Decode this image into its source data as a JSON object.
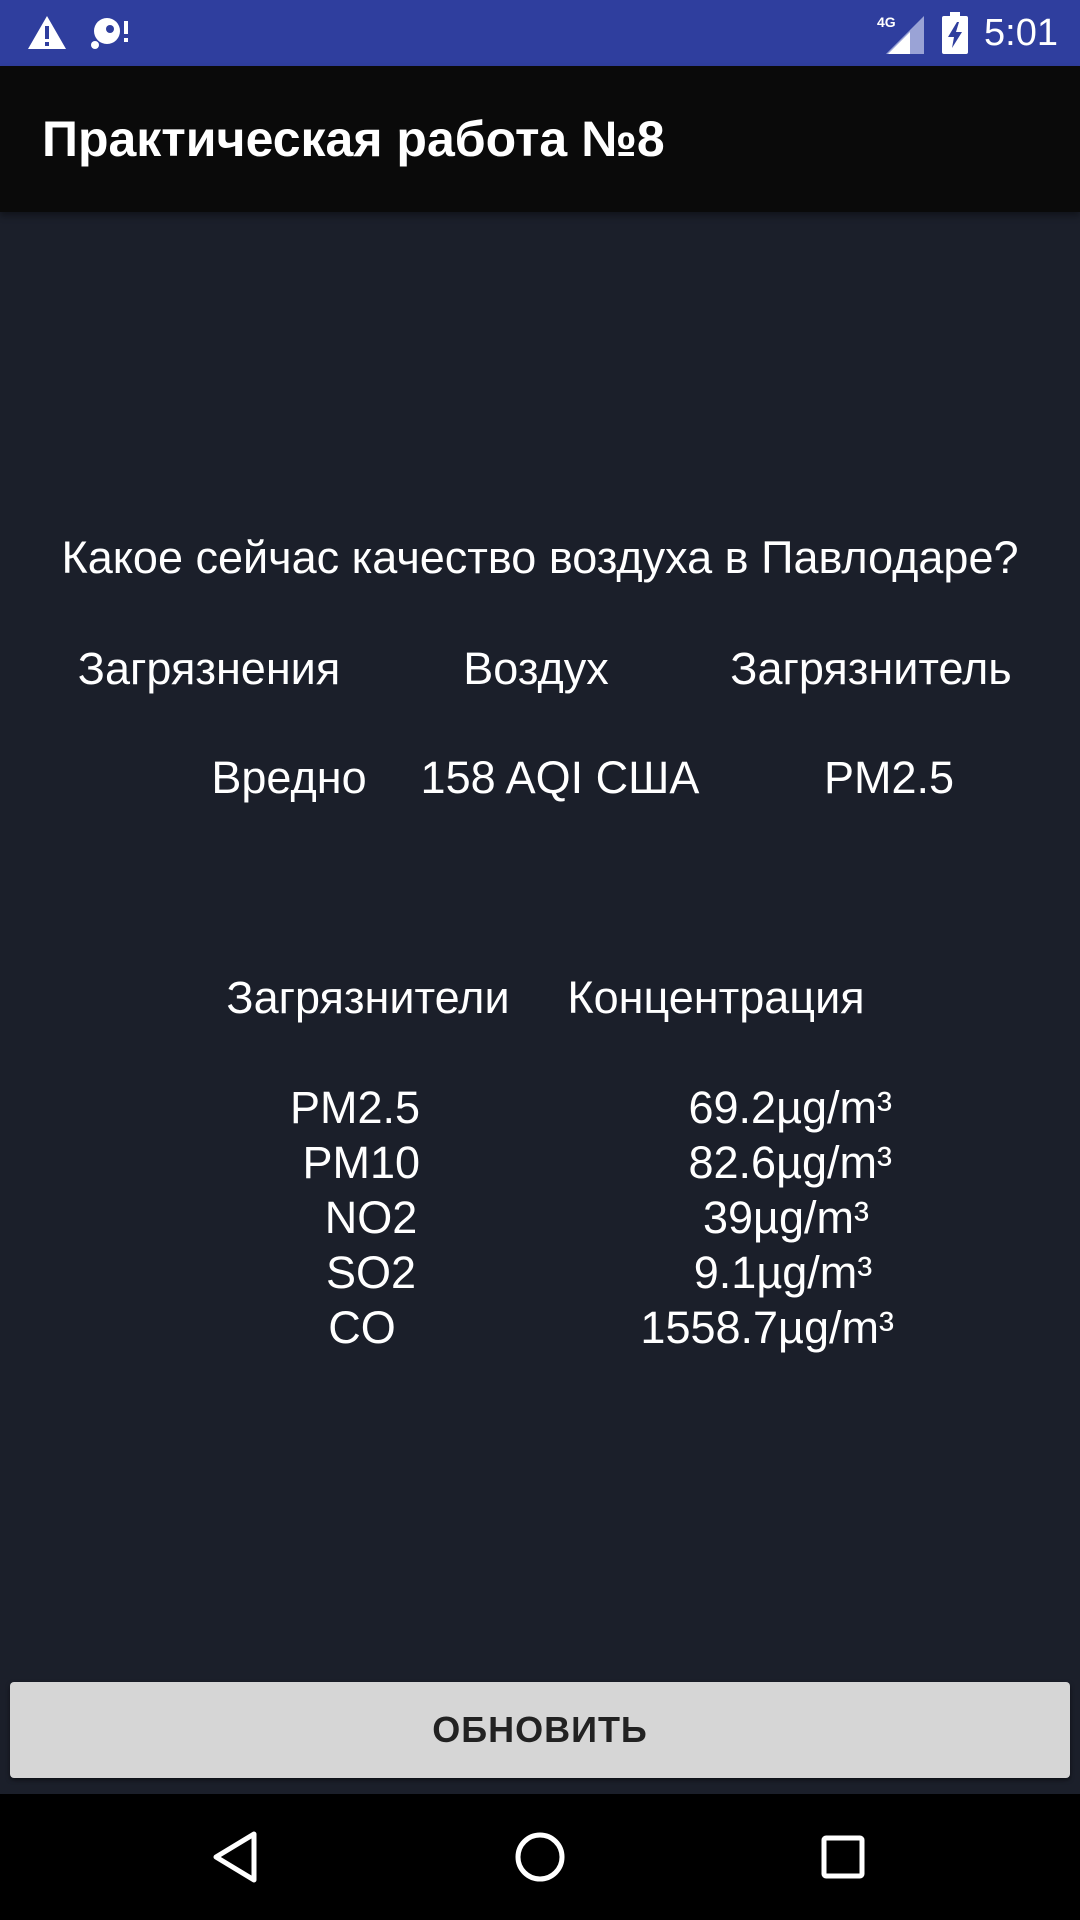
{
  "status_bar": {
    "network": "4G",
    "time": "5:01",
    "icons": [
      "warning-icon",
      "sd-card-icon",
      "signal-icon",
      "battery-charging-icon"
    ]
  },
  "app_bar": {
    "title": "Практическая работа №8"
  },
  "main": {
    "question": "Какое сейчас качество воздуха в Павлодаре?",
    "summary_headers": [
      "Загрязнения",
      "Воздух",
      "Загрязнитель"
    ],
    "summary_values": [
      "Вредно",
      "158 AQI США",
      "PM2.5"
    ],
    "pollutant_headers": [
      "Загрязнители",
      "Концентрация"
    ],
    "pollutants": [
      {
        "name": "PM2.5",
        "concentration": "69.2µg/m³"
      },
      {
        "name": "PM10",
        "concentration": "82.6µg/m³"
      },
      {
        "name": "NO2",
        "concentration": "39µg/m³"
      },
      {
        "name": "SO2",
        "concentration": "9.1µg/m³"
      },
      {
        "name": "CO",
        "concentration": "1558.7µg/m³"
      }
    ]
  },
  "refresh_button": {
    "label": "ОБНОВИТЬ"
  },
  "nav_bar": {
    "icons": [
      "back-icon",
      "home-icon",
      "recents-icon"
    ]
  },
  "colors": {
    "status_bar": "#2f3e9e",
    "app_bar": "#0a0a0a",
    "background": "#1b1f2a",
    "button": "#d6d6d6",
    "text": "#ffffff"
  }
}
